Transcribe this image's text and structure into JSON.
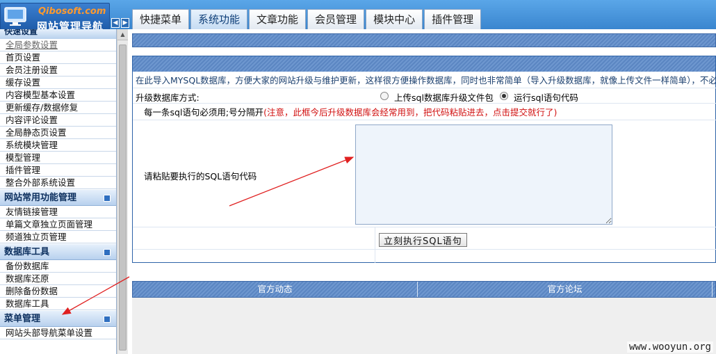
{
  "header": {
    "brand": "Qibosoft.com",
    "title": "网站管理导航",
    "tabs": [
      {
        "label": "快捷菜单"
      },
      {
        "label": "系统功能"
      },
      {
        "label": "文章功能"
      },
      {
        "label": "会员管理"
      },
      {
        "label": "模块中心"
      },
      {
        "label": "插件管理"
      }
    ]
  },
  "sidebar": {
    "partial_header": "快速设置",
    "system_items": [
      "全局参数设置",
      "首页设置",
      "会员注册设置",
      "缓存设置",
      "内容模型基本设置",
      "更新缓存/数据修复",
      "内容评论设置",
      "全局静态页设置",
      "系统模块管理",
      "模型管理",
      "插件管理",
      "整合外部系统设置"
    ],
    "section_common": "网站常用功能管理",
    "common_items": [
      "友情链接管理",
      "单篇文章独立页面管理",
      "频道独立页管理"
    ],
    "section_db": "数据库工具",
    "db_items": [
      "备份数据库",
      "数据库还原",
      "删除备份数据",
      "数据库工具"
    ],
    "section_menu": "菜单管理",
    "menu_items": [
      "网站头部导航菜单设置"
    ]
  },
  "main": {
    "intro": "在此导入MYSQL数据库，方便大家的网站升级与维护更新，这样很方便操作数据库，同时也非常简单（导入升级数据库，就像上传文件一样简单），不必再那么",
    "method_label": "升级数据库方式:",
    "option_upload": "上传sql数据库升级文件包",
    "option_run": "运行sql语句代码",
    "note_prefix": "每一条sql语句必须用;号分隔开",
    "note_warning": "(注意，此框今后升级数据库会经常用到，把代码粘贴进去，点击提交就行了)",
    "sql_label": "请粘贴要执行的SQL语句代码",
    "sql_value": "",
    "execute_button": "立刻执行SQL语句"
  },
  "footer": {
    "col1": "官方动态",
    "col2": "官方论坛"
  },
  "watermark": "www.wooyun.org",
  "colors": {
    "accent_blue": "#3a86cf",
    "warning_red": "#d11010",
    "annotation_red": "#e02020"
  }
}
